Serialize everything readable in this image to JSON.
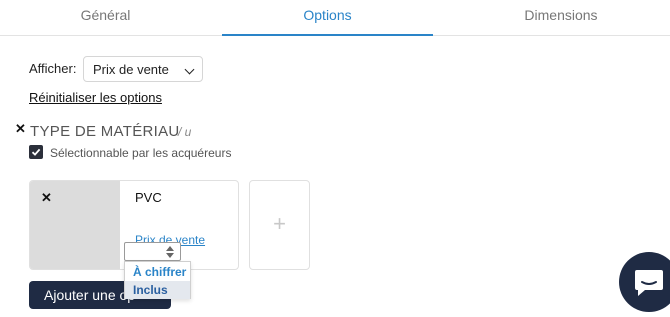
{
  "tabs": [
    {
      "label": "Général",
      "active": false
    },
    {
      "label": "Options",
      "active": true
    },
    {
      "label": "Dimensions",
      "active": false
    }
  ],
  "display": {
    "label": "Afficher:",
    "selected": "Prix de vente"
  },
  "reset_link": "Réinitialiser les options",
  "section": {
    "title": "TYPE DE MATÉRIAU",
    "unit": "/ u",
    "checkbox_label": "Sélectionnable par les acquéreurs",
    "checkbox_checked": true
  },
  "option_card": {
    "name": "PVC",
    "price_link": "Prix de vente"
  },
  "add_card_symbol": "+",
  "price_dropdown": {
    "options": [
      "À chiffrer",
      "Inclus"
    ],
    "highlighted": "Inclus"
  },
  "add_option_button": "Ajouter une op",
  "icons": {
    "remove": "close-icon",
    "checkbox": "checkmark-icon",
    "add": "plus-icon",
    "chat": "chat-bubble-icon"
  },
  "colors": {
    "accent": "#2a84c8",
    "dark": "#1f2b44",
    "placeholder_image": "#dcdcdc"
  }
}
